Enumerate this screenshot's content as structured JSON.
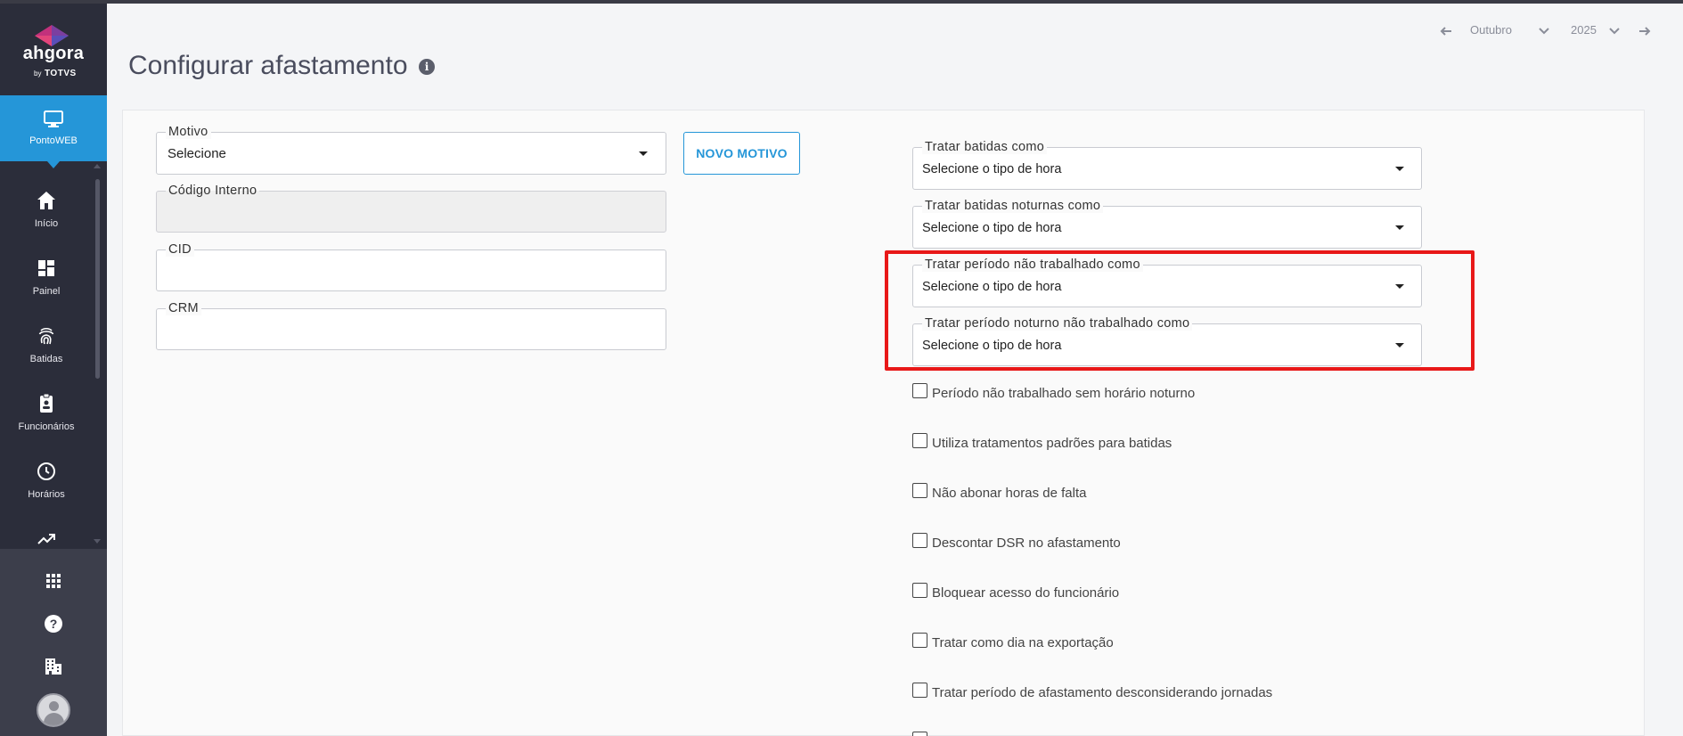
{
  "brand": {
    "name": "ahgora",
    "by": "by",
    "partner": "TOTVS"
  },
  "sidebar": {
    "active": {
      "label": "PontoWEB"
    },
    "items": [
      {
        "label": "Início",
        "icon": "home-icon"
      },
      {
        "label": "Painel",
        "icon": "dashboard-icon"
      },
      {
        "label": "Batidas",
        "icon": "fingerprint-icon"
      },
      {
        "label": "Funcionários",
        "icon": "badge-icon"
      },
      {
        "label": "Horários",
        "icon": "clock-icon"
      },
      {
        "label": "",
        "icon": "trending-up-icon"
      }
    ],
    "bottom_icons": [
      "apps-grid-icon",
      "help-icon",
      "building-icon",
      "avatar"
    ]
  },
  "header": {
    "title": "Configurar afastamento",
    "month": "Outubro",
    "year": "2025"
  },
  "form": {
    "motivo": {
      "label": "Motivo",
      "value": "Selecione"
    },
    "novo_motivo_label": "NOVO MOTIVO",
    "codigo_interno": {
      "label": "Código Interno",
      "value": ""
    },
    "cid": {
      "label": "CID",
      "value": ""
    },
    "crm": {
      "label": "CRM",
      "value": ""
    },
    "selects": [
      {
        "label": "Tratar batidas como",
        "value": "Selecione o tipo de hora"
      },
      {
        "label": "Tratar batidas noturnas como",
        "value": "Selecione o tipo de hora"
      },
      {
        "label": "Tratar período não trabalhado como",
        "value": "Selecione o tipo de hora"
      },
      {
        "label": "Tratar período noturno não trabalhado como",
        "value": "Selecione o tipo de hora"
      }
    ],
    "checkboxes": [
      {
        "label": "Período não trabalhado sem horário noturno",
        "checked": false
      },
      {
        "label": "Utiliza tratamentos padrões para batidas",
        "checked": false
      },
      {
        "label": "Não abonar horas de falta",
        "checked": false
      },
      {
        "label": "Descontar DSR no afastamento",
        "checked": false
      },
      {
        "label": "Bloquear acesso do funcionário",
        "checked": false
      },
      {
        "label": "Tratar como dia na exportação",
        "checked": false
      },
      {
        "label": "Tratar período de afastamento desconsiderando jornadas",
        "checked": false
      }
    ]
  },
  "colors": {
    "sidebar_bg": "#2b2d3a",
    "accent": "#2596d8",
    "highlight": "#e81818"
  }
}
